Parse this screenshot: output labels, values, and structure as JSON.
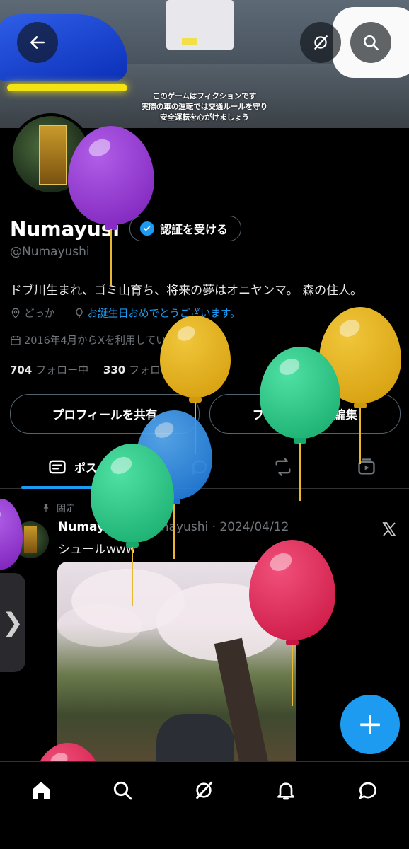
{
  "banner": {
    "caption_lines": [
      "このゲームはフィクションです",
      "実際の車の運転では交通ルールを守り",
      "安全運転を心がけましょう"
    ]
  },
  "profile": {
    "name": "Numayusi",
    "verify_label": "認証を受ける",
    "handle": "@Numayushi",
    "bio": "ドブ川生まれ、ゴミ山育ち、将来の夢はオニヤンマ。 森の住人。",
    "location": "どっか",
    "birthday": "お誕生日おめでとうございます。",
    "joined": "2016年4月からXを利用しています",
    "following_count": "704",
    "following_label": "フォロー中",
    "followers_count": "330",
    "followers_label": "フォロワー",
    "share_label": "プロフィールを共有",
    "edit_label": "プロフィールを編集"
  },
  "tabs": {
    "posts_label": "ポスト"
  },
  "post": {
    "pinned_label": "固定",
    "author": "Numayusi",
    "handle_date": "@Numayushi · 2024/04/12",
    "text": "シュールwww"
  },
  "side_tab": {
    "glyph": "❯"
  },
  "fab": {
    "glyph": "+"
  },
  "colors": {
    "accent": "#1d9bf0",
    "background": "#000000",
    "muted": "#71767b"
  }
}
